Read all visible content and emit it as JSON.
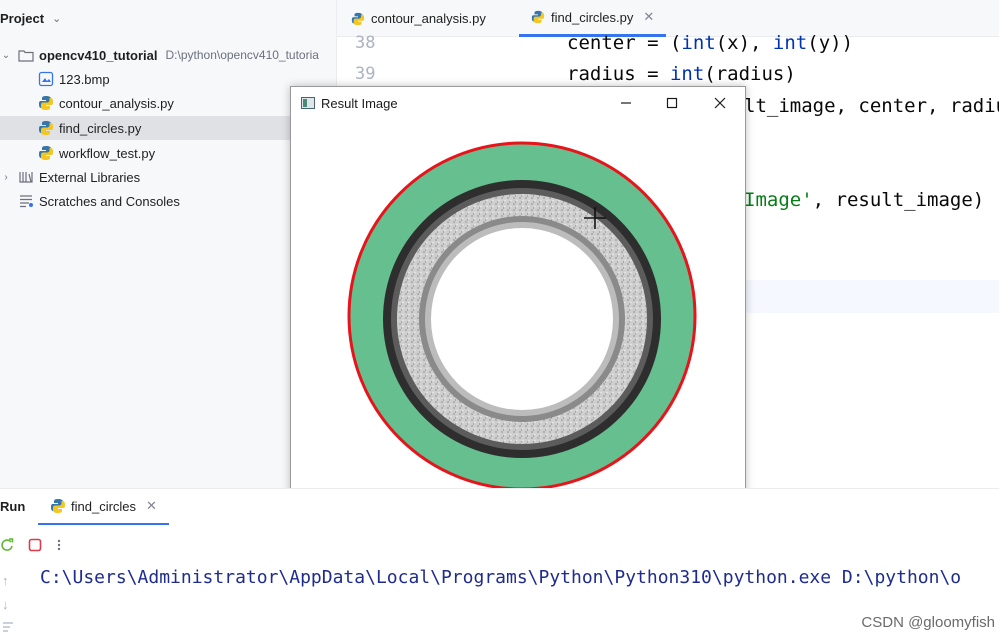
{
  "project": {
    "header": "Project",
    "tree": [
      {
        "label": "opencv410_tutorial",
        "path": "D:\\python\\opencv410_tutoria"
      },
      {
        "label": "123.bmp"
      },
      {
        "label": "contour_analysis.py"
      },
      {
        "label": "find_circles.py",
        "selected": true
      },
      {
        "label": "workflow_test.py"
      },
      {
        "label": "External Libraries"
      },
      {
        "label": "Scratches and Consoles"
      }
    ]
  },
  "editor": {
    "tabs": [
      {
        "label": "contour_analysis.py"
      },
      {
        "label": "find_circles.py",
        "active": true
      }
    ],
    "line_numbers": [
      "38",
      "39"
    ],
    "code": {
      "l38_a": "center = (",
      "l38_kw1": "int",
      "l38_b": "(x), ",
      "l38_kw2": "int",
      "l38_c": "(y))",
      "l39_a": "radius = ",
      "l39_kw": "int",
      "l39_b": "(radius)",
      "l40": "lt_image, center, radiu",
      "l41_str": "Image'",
      "l41_b": ", result_image)"
    }
  },
  "result_window": {
    "title": "Result Image",
    "colors": {
      "fill": "#66bf8e",
      "outline": "#e8141b",
      "ring_dark": "#3a3a3a",
      "ring_light": "#d6d6d6"
    }
  },
  "run": {
    "label": "Run",
    "tab": "find_circles",
    "console": "C:\\Users\\Administrator\\AppData\\Local\\Programs\\Python\\Python310\\python.exe D:\\python\\o"
  },
  "watermark": "CSDN @gloomyfish"
}
